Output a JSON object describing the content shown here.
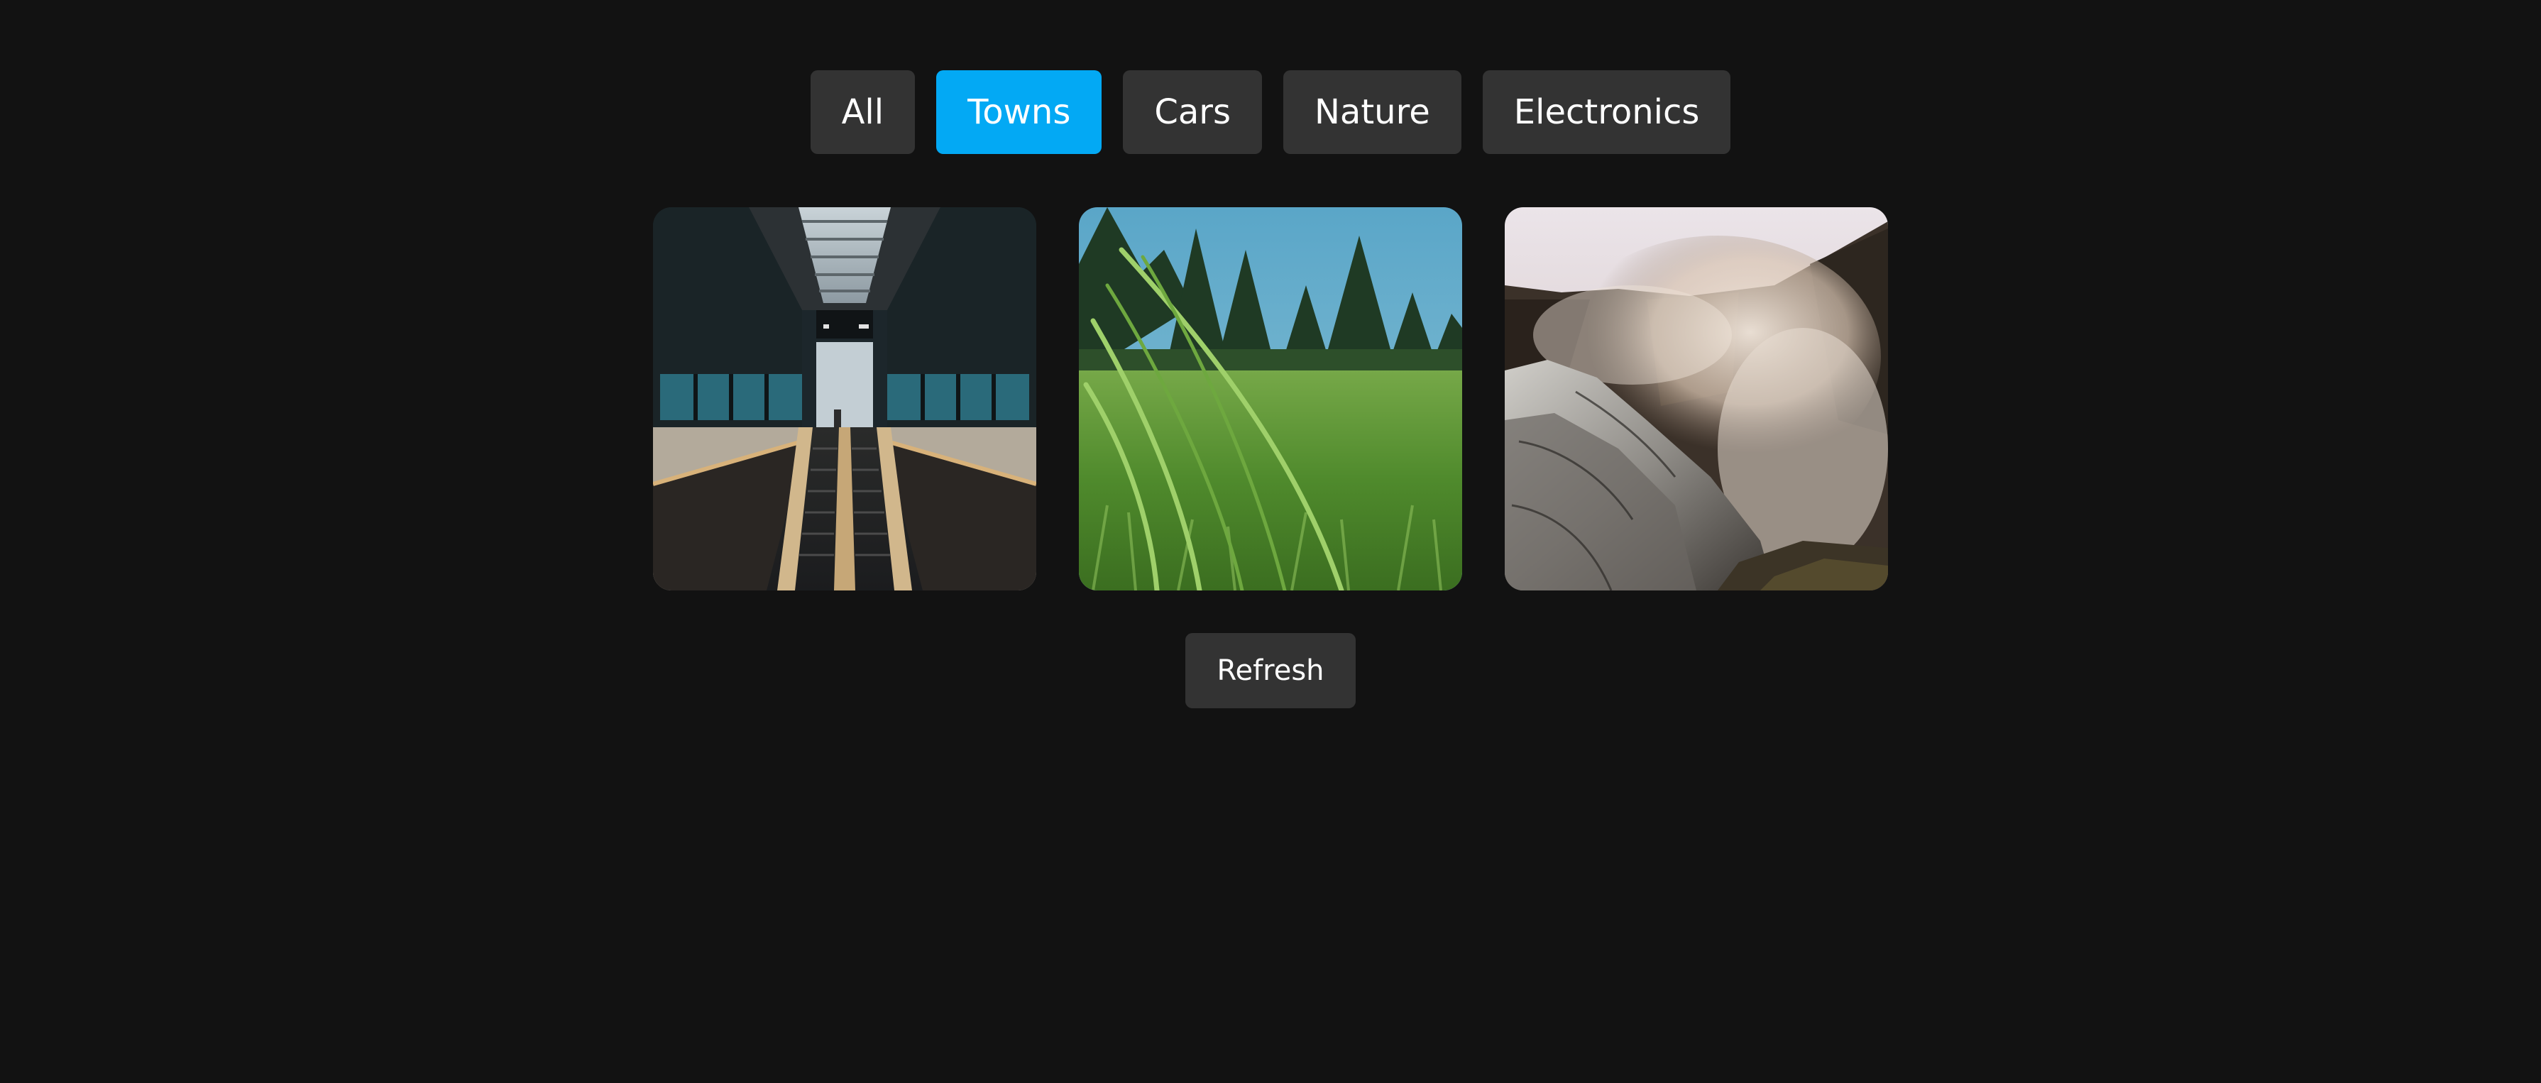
{
  "filters": {
    "items": [
      {
        "label": "All",
        "active": false
      },
      {
        "label": "Towns",
        "active": true
      },
      {
        "label": "Cars",
        "active": false
      },
      {
        "label": "Nature",
        "active": false
      },
      {
        "label": "Electronics",
        "active": false
      }
    ],
    "active_color": "#03a9f4",
    "inactive_color": "#333333"
  },
  "gallery": {
    "images": [
      {
        "subject": "escalator-station-photo"
      },
      {
        "subject": "grass-field-photo"
      },
      {
        "subject": "waterfall-rocks-photo"
      }
    ]
  },
  "refresh": {
    "label": "Refresh"
  },
  "colors": {
    "background": "#121212",
    "button": "#333333",
    "accent": "#03a9f4",
    "text": "#ffffff"
  }
}
